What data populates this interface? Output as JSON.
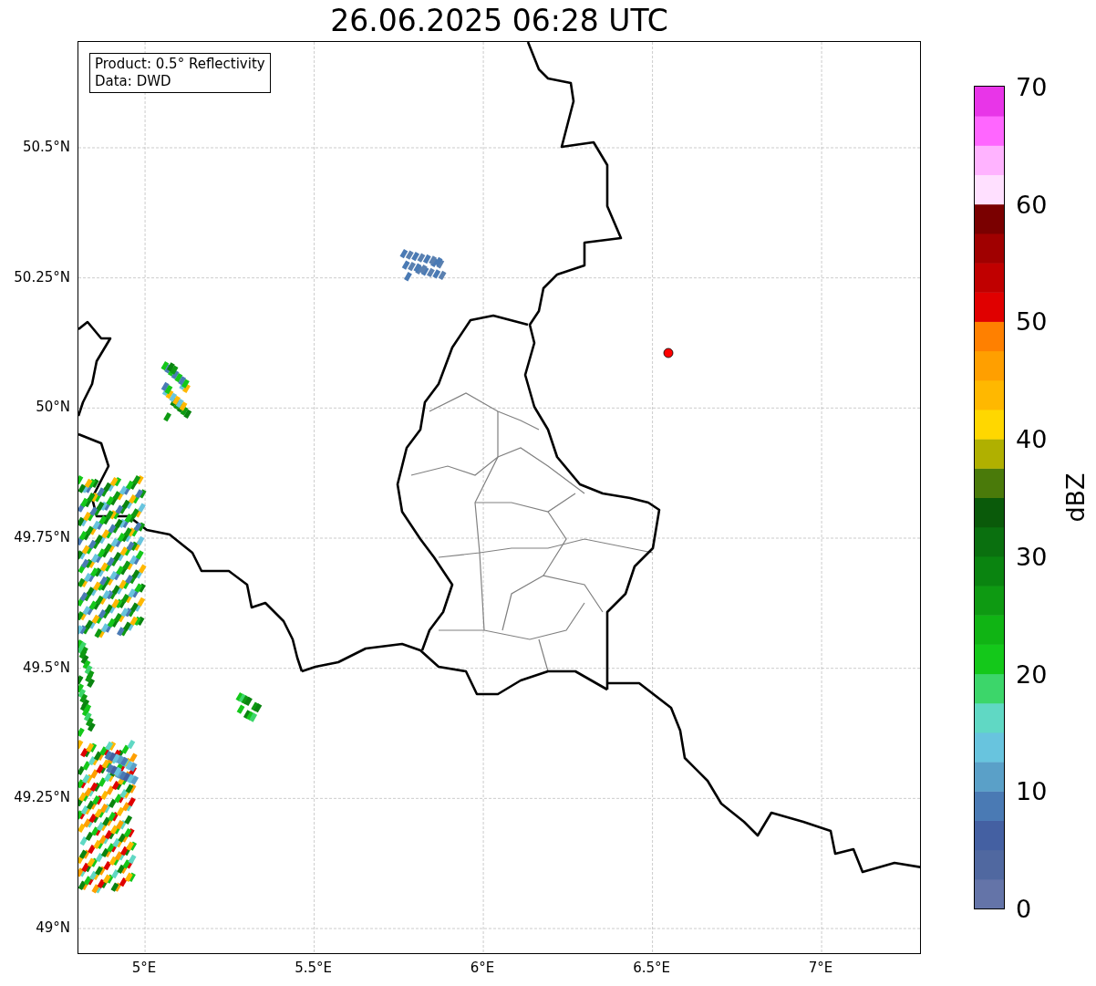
{
  "title": "26.06.2025 06:28 UTC",
  "legend_lines": [
    "Product: 0.5° Reflectivity",
    "Data: DWD"
  ],
  "y_ticks": [
    "50.5°N",
    "50.25°N",
    "50°N",
    "49.75°N",
    "49.5°N",
    "49.25°N",
    "49°N"
  ],
  "x_ticks": [
    "5°E",
    "5.5°E",
    "6°E",
    "6.5°E",
    "7°E"
  ],
  "colorbar": {
    "label": "dBZ",
    "ticks": [
      "70",
      "60",
      "50",
      "40",
      "30",
      "20",
      "10",
      "0"
    ],
    "segments": [
      {
        "color": "#6474a8"
      },
      {
        "color": "#5068a0"
      },
      {
        "color": "#4460a2"
      },
      {
        "color": "#4a7ab4"
      },
      {
        "color": "#5aa0c8"
      },
      {
        "color": "#68c4de"
      },
      {
        "color": "#60d8c4"
      },
      {
        "color": "#3cd66a"
      },
      {
        "color": "#14c81a"
      },
      {
        "color": "#10b414"
      },
      {
        "color": "#0e9a12"
      },
      {
        "color": "#0a8410"
      },
      {
        "color": "#0a700f"
      },
      {
        "color": "#0a5a0a"
      },
      {
        "color": "#4a7a0a"
      },
      {
        "color": "#b0b000"
      },
      {
        "color": "#ffd700"
      },
      {
        "color": "#ffb800"
      },
      {
        "color": "#ff9f00"
      },
      {
        "color": "#ff8000"
      },
      {
        "color": "#e00000"
      },
      {
        "color": "#c00000"
      },
      {
        "color": "#a00000"
      },
      {
        "color": "#7a0000"
      },
      {
        "color": "#ffe0ff"
      },
      {
        "color": "#ffb3ff"
      },
      {
        "color": "#ff66ff"
      },
      {
        "color": "#e835e8"
      }
    ]
  }
}
